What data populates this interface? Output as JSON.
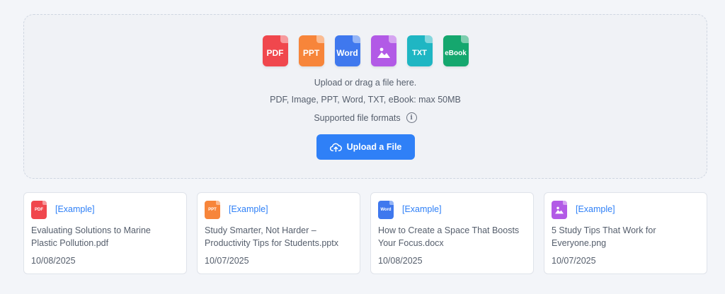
{
  "colors": {
    "pdf": "#f0474d",
    "ppt": "#f7853a",
    "word": "#3f78ee",
    "image": "#b25ae6",
    "txt": "#1fb6c3",
    "ebook": "#15a76e",
    "primary": "#2f80f7"
  },
  "upload": {
    "formats": [
      {
        "key": "pdf",
        "label": "PDF"
      },
      {
        "key": "ppt",
        "label": "PPT"
      },
      {
        "key": "word",
        "label": "Word"
      },
      {
        "key": "image",
        "label": ""
      },
      {
        "key": "txt",
        "label": "TXT"
      },
      {
        "key": "ebook",
        "label": "eBook"
      }
    ],
    "instruction": "Upload or drag a file here.",
    "limits": "PDF, Image, PPT, Word, TXT, eBook: max 50MB",
    "supported_label": "Supported file formats",
    "button_label": "Upload a File"
  },
  "examples": [
    {
      "type": "pdf",
      "icon_label": "PDF",
      "tag": "[Example]",
      "title": "Evaluating Solutions to Marine Plastic Pollution.pdf",
      "date": "10/08/2025"
    },
    {
      "type": "ppt",
      "icon_label": "PPT",
      "tag": "[Example]",
      "title": "Study Smarter, Not Harder – Productivity Tips for Students.pptx",
      "date": "10/07/2025"
    },
    {
      "type": "word",
      "icon_label": "Word",
      "tag": "[Example]",
      "title": "How to Create a Space That Boosts Your Focus.docx",
      "date": "10/08/2025"
    },
    {
      "type": "image",
      "icon_label": "",
      "tag": "[Example]",
      "title": "5 Study Tips That Work for Everyone.png",
      "date": "10/07/2025"
    }
  ]
}
